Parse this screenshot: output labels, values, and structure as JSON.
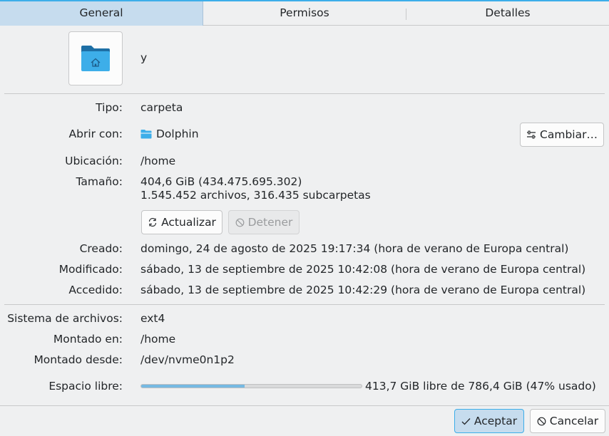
{
  "tabs": [
    {
      "label": "General",
      "active": true
    },
    {
      "label": "Permisos",
      "active": false
    },
    {
      "label": "Detalles",
      "active": false
    }
  ],
  "header": {
    "name": "y",
    "icon": "folder-home-icon"
  },
  "fields": {
    "tipo_label": "Tipo:",
    "tipo_value": "carpeta",
    "abrir_label": "Abrir con:",
    "abrir_value": "Dolphin",
    "cambiar_button": "Cambiar…",
    "ubicacion_label": "Ubicación:",
    "ubicacion_value": "/home",
    "tamano_label": "Tamaño:",
    "tamano_value": "404,6 GiB (434.475.695.302)",
    "tamano_value2": "1.545.452 archivos, 316.435 subcarpetas",
    "actualizar_button": "Actualizar",
    "detener_button": "Detener",
    "creado_label": "Creado:",
    "creado_value": "domingo, 24 de agosto de 2025 19:17:34 (hora de verano de Europa central)",
    "modificado_label": "Modificado:",
    "modificado_value": "sábado, 13 de septiembre de 2025 10:42:08 (hora de verano de Europa central)",
    "accedido_label": "Accedido:",
    "accedido_value": "sábado, 13 de septiembre de 2025 10:42:29 (hora de verano de Europa central)",
    "fs_label": "Sistema de archivos:",
    "fs_value": "ext4",
    "montado_en_label": "Montado en:",
    "montado_en_value": "/home",
    "montado_desde_label": "Montado desde:",
    "montado_desde_value": "/dev/nvme0n1p2",
    "espacio_label": "Espacio libre:",
    "espacio_value": "413,7 GiB libre de 786,4 GiB (47% usado)",
    "espacio_used_fraction": 0.47
  },
  "footer": {
    "accept": "Aceptar",
    "cancel": "Cancelar"
  },
  "colors": {
    "accent": "#3daee9",
    "selection": "#c6dcee",
    "progress": "#76b9e2"
  }
}
